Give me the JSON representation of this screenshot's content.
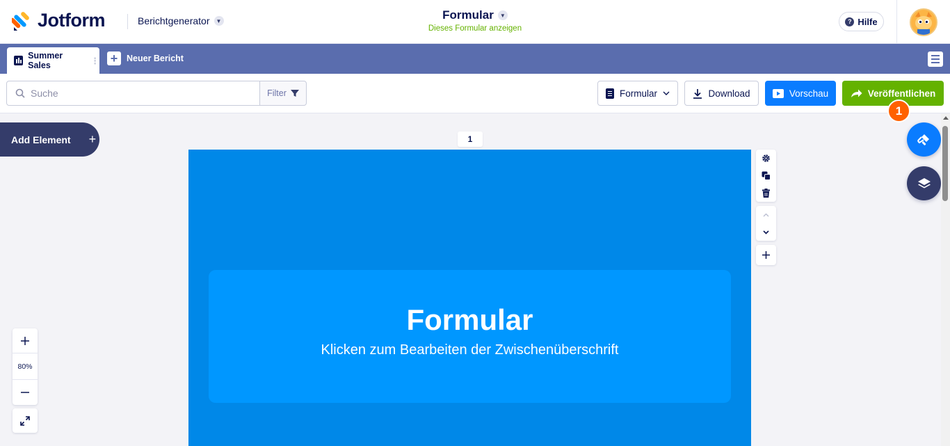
{
  "header": {
    "brand": "Jotform",
    "app_switcher": "Berichtgenerator",
    "form_title": "Formular",
    "form_subtitle": "Dieses Formular anzeigen",
    "help_label": "Hilfe"
  },
  "tabs": {
    "active_label": "Summer Sales",
    "new_label": "Neuer Bericht"
  },
  "toolbar": {
    "search_placeholder": "Suche",
    "filter_label": "Filter",
    "form_select": "Formular",
    "download_label": "Download",
    "preview_label": "Vorschau",
    "publish_label": "Veröffentlichen",
    "badge": "1"
  },
  "canvas": {
    "add_element": "Add Element",
    "page_number": "1",
    "slide_title": "Formular",
    "slide_subtitle": "Klicken zum Bearbeiten der Zwischenüberschrift",
    "zoom_level": "80%"
  },
  "colors": {
    "header_bar": "#5a6dae",
    "publish": "#64b200",
    "preview": "#0a7cff",
    "slide_background": "#0088e8",
    "slide_box": "#0097ff",
    "badge": "#ff6100"
  },
  "icons": [
    "jotform-logo",
    "chevron-down-icon",
    "help-icon",
    "avatar",
    "report-icon",
    "plus-icon",
    "hamburger-menu-icon",
    "search-icon",
    "filter-icon",
    "document-icon",
    "download-icon",
    "play-icon",
    "share-arrow-icon",
    "gear-icon",
    "duplicate-icon",
    "trash-icon",
    "chevron-up-icon",
    "zoom-in-icon",
    "zoom-out-icon",
    "expand-icon",
    "paint-roller-icon",
    "layers-icon"
  ]
}
